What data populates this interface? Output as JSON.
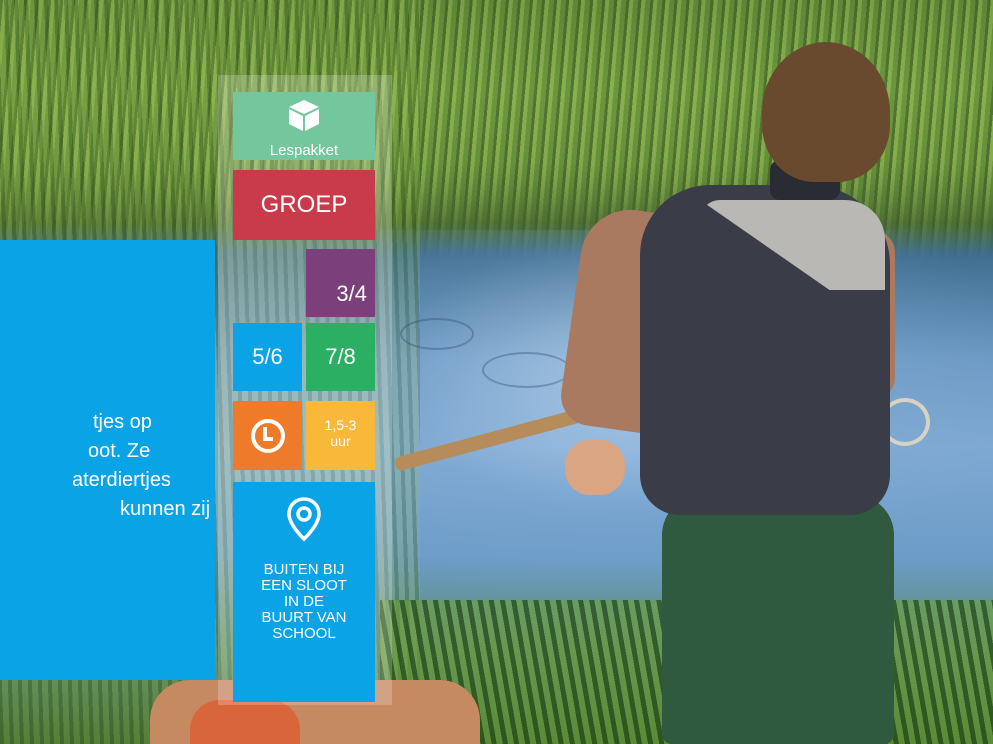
{
  "badges": {
    "lespakket": {
      "icon": "box-icon",
      "label": "Lespakket",
      "color": "#74c69c"
    },
    "groep": {
      "label": "GROEP",
      "color": "#c93a4b"
    },
    "grades": [
      {
        "label": "3/4",
        "color": "#7b3f7c"
      },
      {
        "label": "5/6",
        "color": "#0aa3e6"
      },
      {
        "label": "7/8",
        "color": "#2bb063"
      }
    ],
    "duration": {
      "icon": "clock-icon",
      "line1": "1,5-3",
      "line2": "uur",
      "color": "#f8b83a",
      "icon_bg": "#ef7a2a"
    },
    "location": {
      "icon": "location-pin-icon",
      "lines": [
        "BUITEN BIJ",
        "EEN SLOOT",
        "IN DE",
        "BUURT VAN",
        "SCHOOL"
      ],
      "color": "#0aa3e6"
    }
  },
  "info_panel": {
    "color": "#0aa3e6",
    "lines": [
      "tjes op",
      "oot. Ze",
      "aterdiertjes",
      "kunnen zij"
    ]
  }
}
